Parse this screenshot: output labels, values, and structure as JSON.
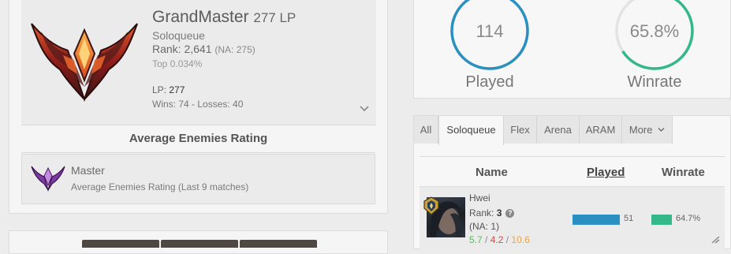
{
  "rank_card": {
    "tier": "GrandMaster",
    "lp_short": "277 LP",
    "queue": "Soloqueue",
    "rank_label": "Rank: 2,641",
    "rank_na": "(NA: 275)",
    "top_percent": "Top 0.034%",
    "lp_label": "LP: ",
    "lp_value": "277",
    "wins_losses": "Wins: 74 - Losses: 40",
    "expand_icon": "chevron-down-icon"
  },
  "average_enemies": {
    "heading": "Average Enemies Rating",
    "tier": "Master",
    "description": "Average Enemies Rating (Last 9 matches)"
  },
  "stats": {
    "played_value": "114",
    "played_label": "Played",
    "winrate_value": "65.8%",
    "winrate_label": "Winrate",
    "played_fraction": 1.0,
    "winrate_fraction": 0.658,
    "played_color": "#2a8fc1",
    "winrate_color": "#34b889"
  },
  "tabs": [
    "All",
    "Soloqueue",
    "Flex",
    "Arena",
    "ARAM",
    "More"
  ],
  "active_tab": "Soloqueue",
  "table": {
    "headers": {
      "name": "Name",
      "played": "Played",
      "winrate": "Winrate"
    },
    "rows": [
      {
        "champion": "Hwei",
        "rank_label": "Rank: ",
        "rank_value": "3",
        "na": "(NA: 1)",
        "kills": "5.7",
        "deaths": "4.2",
        "assists": "10.6",
        "played": "51",
        "winrate": "64.7%"
      }
    ]
  },
  "colors": {
    "grandmaster_accent": "#c0392b",
    "master_accent": "#8e44ad",
    "played_bar": "#2a8fc1",
    "winrate_bar": "#34b889"
  }
}
